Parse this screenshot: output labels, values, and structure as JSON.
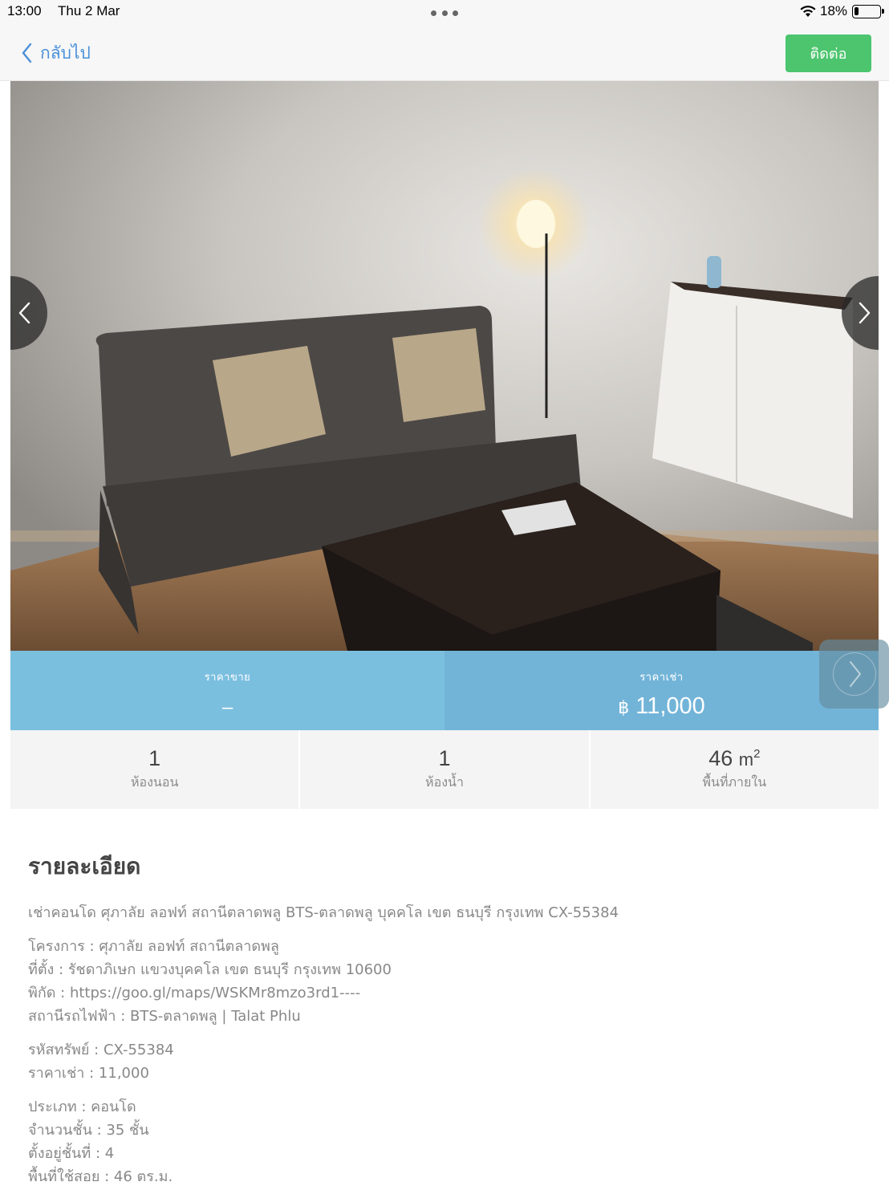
{
  "status_bar": {
    "time": "13:00",
    "date": "Thu 2 Mar",
    "battery_percent": "18%",
    "battery_level": 0.18,
    "icons": [
      "wifi-icon",
      "battery-icon"
    ]
  },
  "nav": {
    "back_label": "กลับไป",
    "back_icon": "chevron-left-icon",
    "contact_label": "ติดต่อ"
  },
  "colors": {
    "accent_blue": "#4a90d9",
    "contact_green": "#4cc56e",
    "price_band": "#7bbfdf",
    "price_band_rent": "#72b4d8"
  },
  "photo": {
    "carousel_prev_icon": "chevron-left-icon",
    "carousel_next_icon": "chevron-right-icon"
  },
  "price": {
    "sale_label": "ราคาขาย",
    "sale_value": "–",
    "rent_label": "ราคาเช่า",
    "currency_symbol": "฿",
    "rent_value": "11,000"
  },
  "stats": {
    "bedrooms_value": "1",
    "bedrooms_label": "ห้องนอน",
    "bathrooms_value": "1",
    "bathrooms_label": "ห้องน้ำ",
    "area_value": "46",
    "area_unit": "m",
    "area_exp": "2",
    "area_label": "พื้นที่ภายใน"
  },
  "details": {
    "title": "รายละเอียด",
    "headline": "เช่าคอนโด ศุภาลัย ลอฟท์ สถานีตลาดพลู BTS-ตลาดพลู บุคคโล เขต ธนบุรี กรุงเทพ CX-55384",
    "group1": [
      "โครงการ : ศุภาลัย ลอฟท์ สถานีตลาดพลู",
      "ที่ตั้ง : รัชดาภิเษก แขวงบุคคโล เขต ธนบุรี กรุงเทพ 10600",
      "พิกัด : https://goo.gl/maps/WSKMr8mzo3rd1----",
      "สถานีรถไฟฟ้า : BTS-ตลาดพลู | Talat Phlu"
    ],
    "group2": [
      "รหัสทรัพย์ : CX-55384",
      "ราคาเช่า : 11,000"
    ],
    "group3": [
      "ประเภท : คอนโด",
      "จำนวนชั้น : 35 ชั้น",
      "ตั้งอยู่ชั้นที่ : 4",
      "พื้นที่ใช้สอย : 46 ตร.ม."
    ]
  }
}
